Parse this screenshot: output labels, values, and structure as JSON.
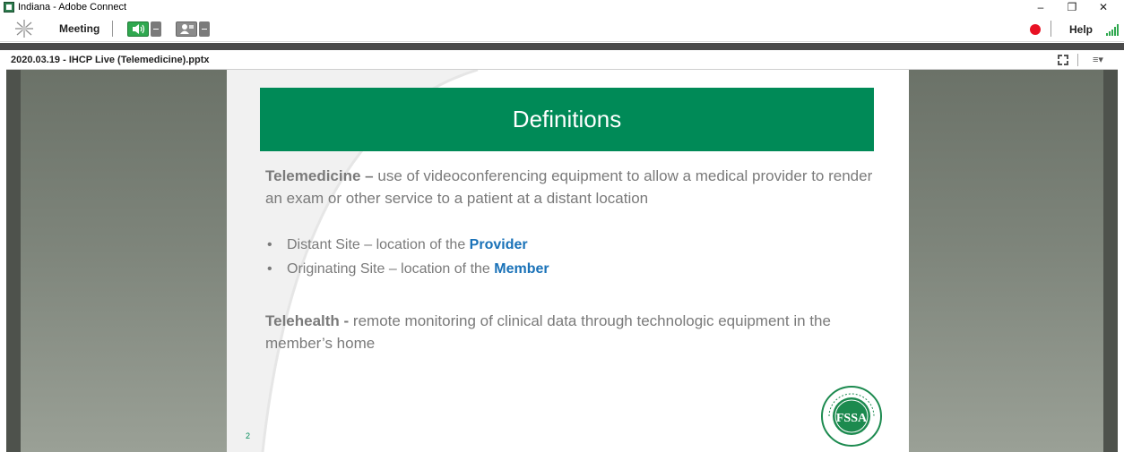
{
  "window": {
    "title": "Indiana - Adobe Connect",
    "minimize": "–",
    "restore": "❐",
    "close": "✕"
  },
  "toolbar": {
    "meeting_label": "Meeting",
    "help_label": "Help",
    "icons": {
      "logo": "adobe-connect-logo",
      "audio": "speaker-icon",
      "camera": "webcam-icon",
      "record": "record-indicator",
      "signal": "connection-signal-icon"
    },
    "colors": {
      "audio_active": "#2fa84f",
      "record": "#e81123",
      "signal": "#2fa84f"
    }
  },
  "pod": {
    "title": "2020.03.19 - IHCP Live (Telemedicine).pptx",
    "menu_glyph": "≡▾"
  },
  "slide": {
    "title": "Definitions",
    "banner_color": "#008a57",
    "telemedicine": {
      "term": "Telemedicine –",
      "text": " use of videoconferencing equipment to allow a medical provider to render an exam or other service to a patient at a distant location"
    },
    "bullets": [
      {
        "text": "Distant Site – location of the ",
        "emph": "Provider"
      },
      {
        "text": "Originating Site – location of the ",
        "emph": "Member"
      }
    ],
    "telehealth": {
      "term": "Telehealth -",
      "text": " remote monitoring of clinical data through technologic equipment in the member’s home"
    },
    "page_number": "2",
    "seal": {
      "name": "fssa-seal",
      "letters": "FSSA",
      "ring_text": "INDIANA FAMILY & SOCIAL SERVICES ADMINISTRATION"
    }
  }
}
